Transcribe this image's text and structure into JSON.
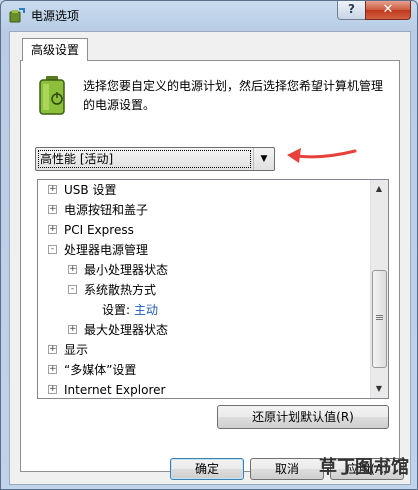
{
  "window": {
    "title": "电源选项",
    "help_label": "?",
    "close_label": "✕"
  },
  "tab": {
    "label": "高级设置"
  },
  "description": "选择您要自定义的电源计划，然后选择您希望计算机管理的电源设置。",
  "plan_select": {
    "value": "高性能 [活动]"
  },
  "tree": [
    {
      "label": "USB 设置",
      "expander": "+",
      "level": 0
    },
    {
      "label": "电源按钮和盖子",
      "expander": "+",
      "level": 0
    },
    {
      "label": "PCI Express",
      "expander": "+",
      "level": 0
    },
    {
      "label": "处理器电源管理",
      "expander": "-",
      "level": 0
    },
    {
      "label": "最小处理器状态",
      "expander": "+",
      "level": 1
    },
    {
      "label": "系统散热方式",
      "expander": "-",
      "level": 1
    },
    {
      "label": "设置:",
      "value": "主动",
      "expander": "",
      "level": 2
    },
    {
      "label": "最大处理器状态",
      "expander": "+",
      "level": 1
    },
    {
      "label": "显示",
      "expander": "+",
      "level": 0
    },
    {
      "label": "“多媒体”设置",
      "expander": "+",
      "level": 0
    },
    {
      "label": "Internet Explorer",
      "expander": "+",
      "level": 0
    }
  ],
  "buttons": {
    "restore": "还原计划默认值(R)",
    "ok": "确定",
    "cancel": "取消",
    "apply": "应用(A)"
  },
  "watermark": {
    "text": "草丁图书馆"
  },
  "colors": {
    "setting_value": "#1f5bb8",
    "arrow": "#e8403a",
    "close": "#c0391e"
  }
}
